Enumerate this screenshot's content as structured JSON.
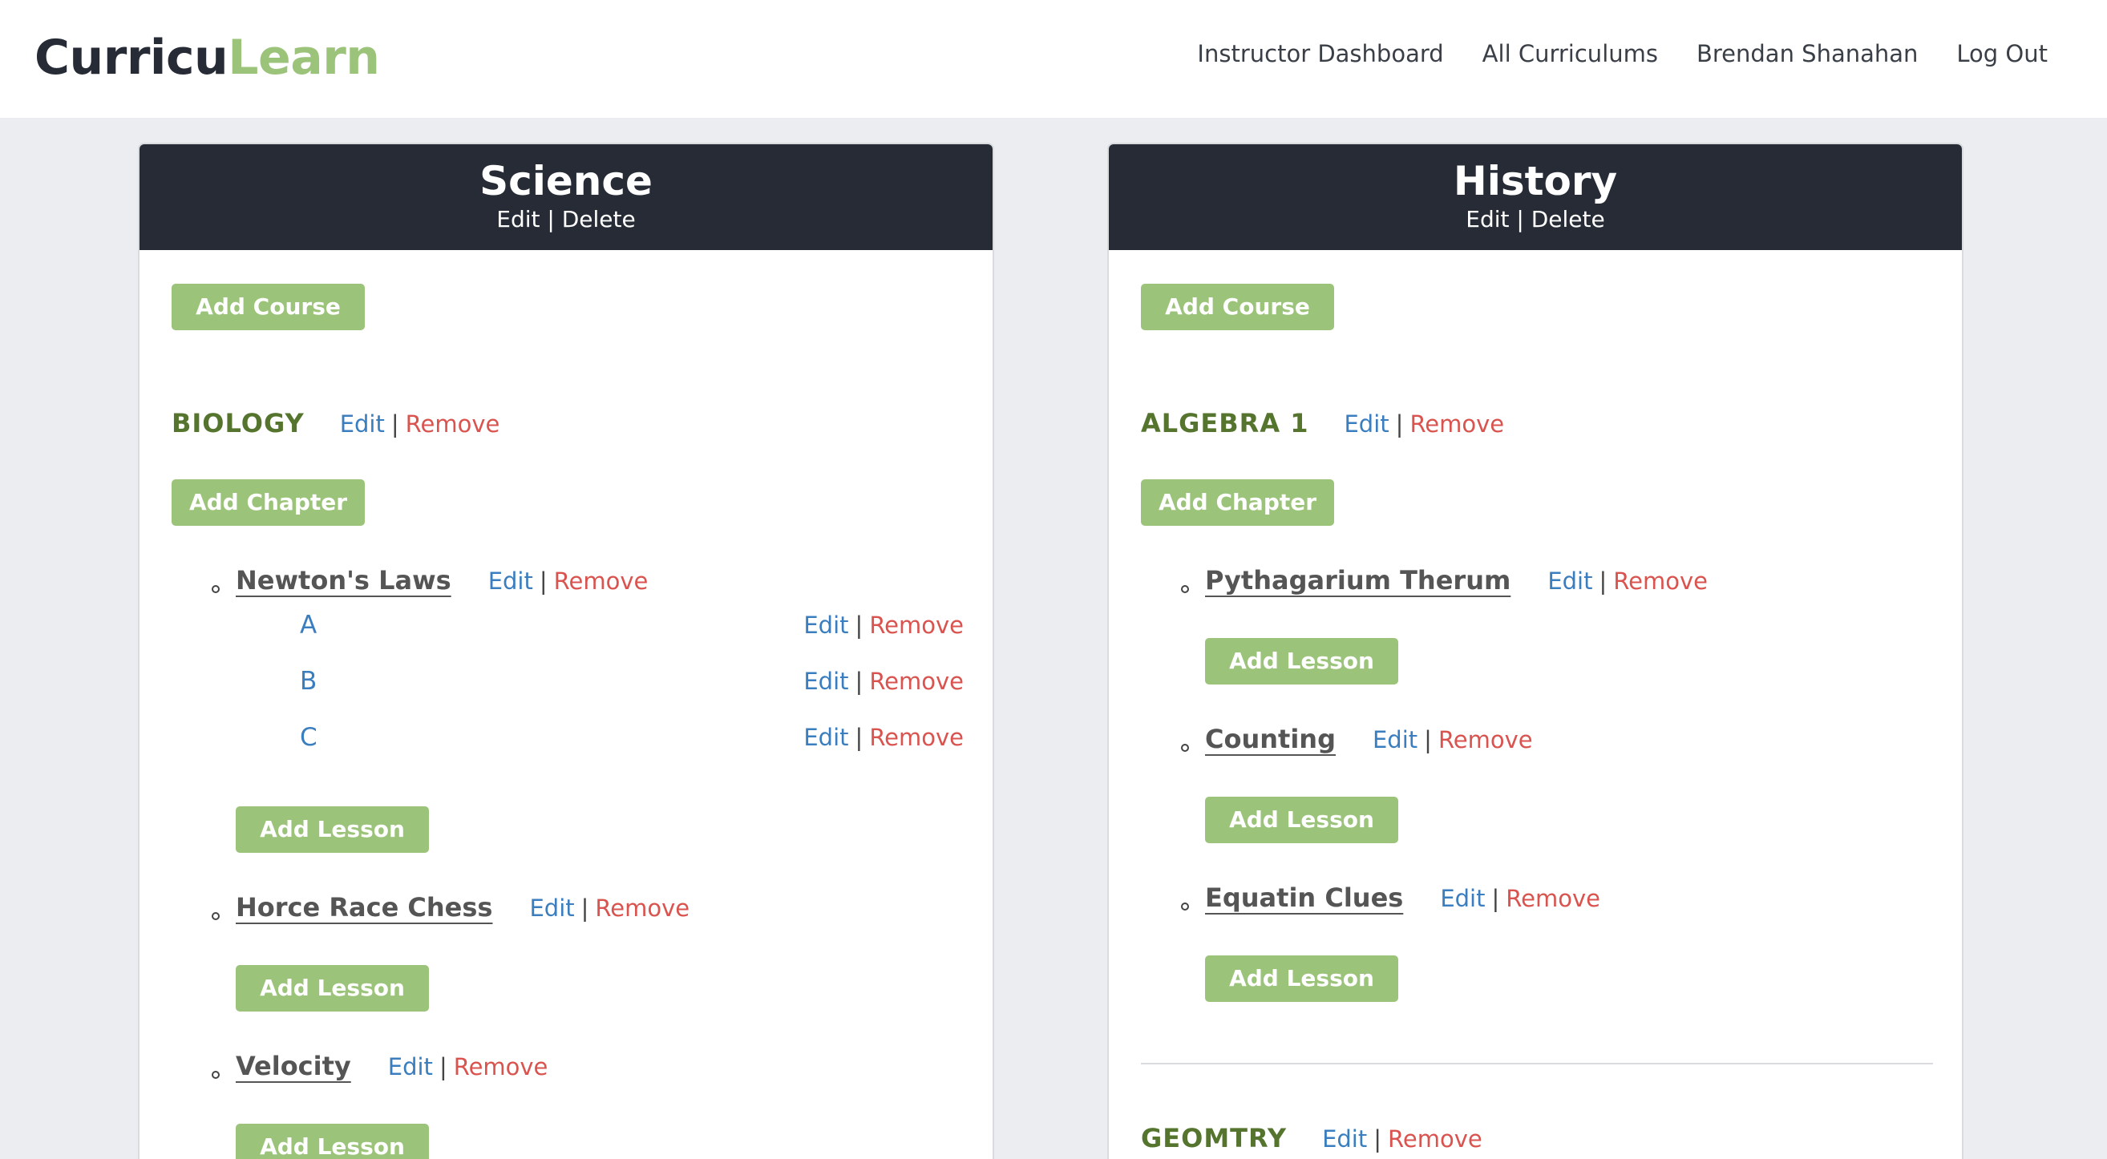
{
  "app": {
    "logo_part1": "Curricu",
    "logo_part2": "Learn"
  },
  "nav": {
    "items": [
      "Instructor Dashboard",
      "All Curriculums",
      "Brendan Shanahan",
      "Log Out"
    ]
  },
  "common": {
    "edit": "Edit",
    "delete": "Delete",
    "remove": "Remove",
    "sep": "|",
    "add_course": "Add Course",
    "add_chapter": "Add Chapter",
    "add_lesson": "Add Lesson"
  },
  "curriculums": [
    {
      "title": "Science",
      "courses": [
        {
          "name": "BIOLOGY",
          "chapters": [
            {
              "name": "Newton's Laws",
              "lessons": [
                "A",
                "B",
                "C"
              ]
            },
            {
              "name": "Horce Race Chess",
              "lessons": []
            },
            {
              "name": "Velocity",
              "lessons": []
            }
          ]
        }
      ]
    },
    {
      "title": "History",
      "courses": [
        {
          "name": "ALGEBRA 1",
          "chapters": [
            {
              "name": "Pythagarium Therum",
              "lessons": []
            },
            {
              "name": "Counting",
              "lessons": []
            },
            {
              "name": "Equatin Clues",
              "lessons": []
            }
          ]
        },
        {
          "name": "GEOMTRY",
          "chapters": []
        }
      ]
    }
  ],
  "colors": {
    "brand_dark": "#262b36",
    "brand_green": "#9bc37a",
    "course_green": "#55752e",
    "link_blue": "#3a7ebf",
    "remove_red": "#d9534f",
    "page_bg": "#ebedf0"
  }
}
